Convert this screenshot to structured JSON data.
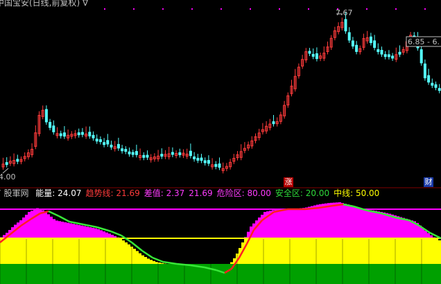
{
  "title": "中国宝安(日线,前复权) ∇",
  "price_panel": {
    "max_label": "7.67",
    "min_label": "4.00",
    "right_label": "6.85 - 6.",
    "markers": {
      "rise_badge": "涨",
      "wealth_badge": "财"
    },
    "colors": {
      "up": "#ff3b3b",
      "down": "#54ffff",
      "dots": "#ff00ff"
    }
  },
  "indicator": {
    "source": "7 股軍网",
    "items": [
      {
        "label": "能量: 24.07",
        "color": "#ffffff"
      },
      {
        "label": "趋势线: 21.69",
        "color": "#ff3b3b"
      },
      {
        "label": "差值: 2.37",
        "color": "#ff3bff"
      },
      {
        "label": "21.69",
        "color": "#ff3bff"
      },
      {
        "label": "危险区: 80.00",
        "color": "#ff3bff"
      },
      {
        "label": "安全区: 20.00",
        "color": "#2eda3a"
      },
      {
        "label": "中线: 50.00",
        "color": "#ffff00"
      }
    ],
    "colors": {
      "energy_fill": "#ff00ff",
      "yellow": "#ffff00",
      "green": "#00a000",
      "trend_up": "#ff2020",
      "trend_down": "#38e838",
      "danger_line": "#ff00ff",
      "mid_line": "#ffff00"
    }
  }
}
